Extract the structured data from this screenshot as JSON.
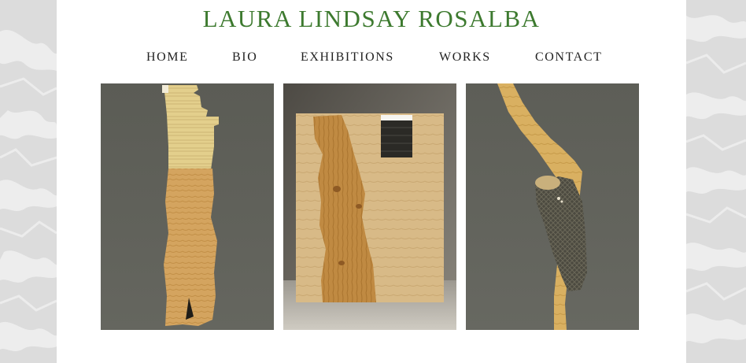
{
  "site": {
    "title": "LAURA LINDSAY ROSALBA"
  },
  "nav": {
    "items": [
      {
        "label": "HOME"
      },
      {
        "label": "BIO"
      },
      {
        "label": "EXHIBITIONS"
      },
      {
        "label": "WORKS"
      },
      {
        "label": "CONTACT"
      }
    ]
  },
  "colors": {
    "title": "#3d7a2f",
    "nav_text": "#222222",
    "page_bg": "#ffffff",
    "side_bg": "#dcdcdc",
    "gallery_wall": "#5e5f58",
    "wood_light": "#d9b36a",
    "wood_dark": "#b98339"
  },
  "gallery": {
    "items": [
      {
        "name": "wood-sculpture-vertical-plank"
      },
      {
        "name": "wood-panel-with-branch-inlay"
      },
      {
        "name": "branch-sculpture-with-bark"
      }
    ]
  }
}
